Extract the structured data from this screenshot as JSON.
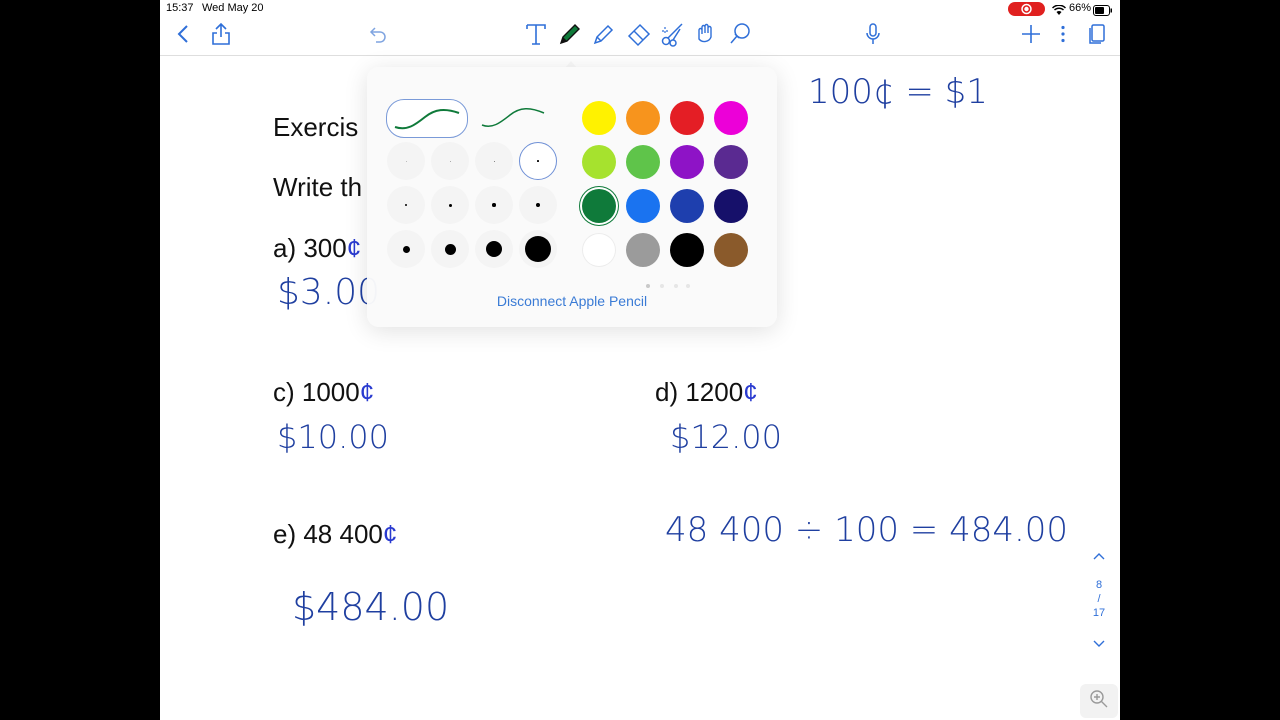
{
  "status": {
    "time": "15:37",
    "date": "Wed May 20",
    "battery": "66%"
  },
  "toolbar": {
    "back_icon": "chevron-left-icon",
    "share_icon": "share-icon",
    "undo_icon": "undo-icon",
    "tools": [
      "text-tool-icon",
      "pen-tool-icon",
      "highlighter-icon",
      "eraser-icon",
      "scissors-icon",
      "hand-icon",
      "lasso-icon"
    ],
    "mic_icon": "microphone-icon",
    "add_icon": "plus-icon",
    "more_icon": "more-icon",
    "pages_icon": "pages-icon"
  },
  "document": {
    "exercise_title": "Exercis",
    "instruction": "Write th",
    "items": [
      {
        "label": "a) 300",
        "cent": "¢",
        "answer": "$3.00"
      },
      {
        "label": "c) 1000",
        "cent": "¢",
        "answer": "$10.00"
      },
      {
        "label": "d) 1200",
        "cent": "¢",
        "answer": "$12.00"
      },
      {
        "label": "e) 48 400",
        "cent": "¢",
        "answer": "$484.00"
      }
    ],
    "note_rate": "100¢ = $1",
    "note_calc": "48 400 ÷ 100 = 484.00"
  },
  "pen_popover": {
    "disconnect_label": "Disconnect Apple Pencil",
    "colors": [
      "#fff200",
      "#f7941d",
      "#e41e25",
      "#ec00d8",
      "#a6e22e",
      "#5fc44a",
      "#8e13c6",
      "#5a2a91",
      "#0f7a3a",
      "#1a73f0",
      "#1e3fae",
      "#16106a",
      "#ffffff",
      "#9b9b9b",
      "#000000",
      "#8a5a2b"
    ],
    "selected_color": "#0f7a3a"
  },
  "page_indicator": {
    "current": "8",
    "separator": "/",
    "total": "17"
  }
}
